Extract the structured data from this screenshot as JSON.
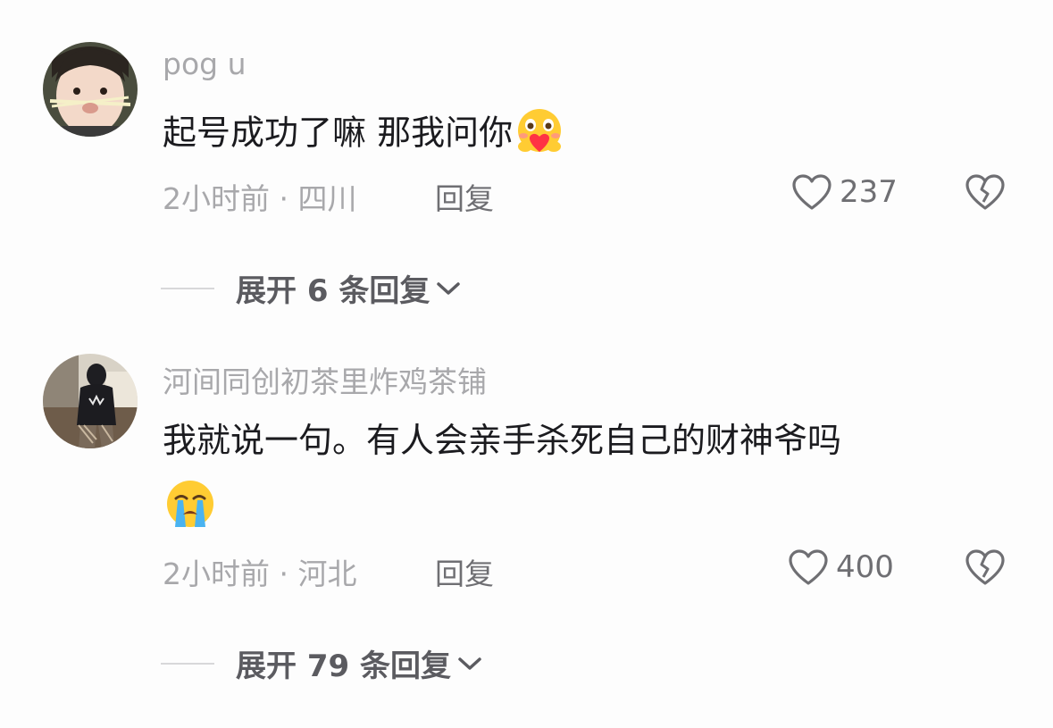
{
  "comments": [
    {
      "username": "pog u",
      "text": "起号成功了嘛 那我问你",
      "text_line2": "",
      "emoji": "hugging-heart-emoji",
      "meta": "2小时前 · 四川",
      "reply_label": "回复",
      "like_count": "237",
      "expand_label": "展开 6 条回复"
    },
    {
      "username": "河间同创初茶里炸鸡茶铺",
      "text": "我就说一句。有人会亲手杀死自己的财神爷吗",
      "text_line2": "",
      "emoji": "loudly-crying-emoji",
      "meta": "2小时前 · 河北",
      "reply_label": "回复",
      "like_count": "400",
      "expand_label": "展开 79 条回复"
    }
  ],
  "icons": {
    "like": "heart-outline-icon",
    "dislike": "broken-heart-icon",
    "expand": "chevron-down-icon"
  },
  "colors": {
    "background": "#fdfdfd",
    "username": "#a8a8ab",
    "body_text": "#1b1b1f",
    "secondary": "#6f6f73"
  }
}
